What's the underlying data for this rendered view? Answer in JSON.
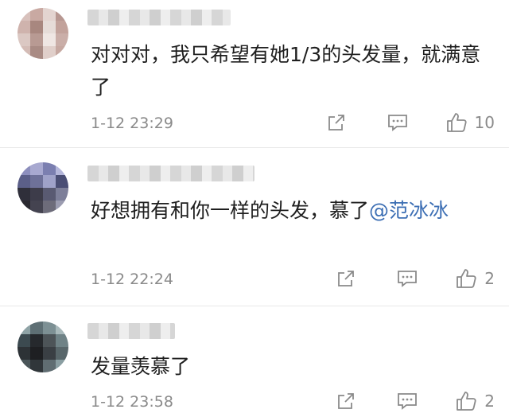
{
  "comments": [
    {
      "text": "对对对，我只希望有她1/3的头发量，就满意了",
      "mention": "",
      "time": "1-12 23:29",
      "likes": "10",
      "avatar_colors": [
        "#d8c1bc",
        "#c9a9a2",
        "#e3d4d0",
        "#b79791",
        "#cfb3ad",
        "#a8877f",
        "#e6dcd8",
        "#c2a29b",
        "#dbc8c3",
        "#b89a93",
        "#efe6e3",
        "#caaea8",
        "#d4bcb6",
        "#a98b84",
        "#e0cfca",
        "#c6a8a1"
      ]
    },
    {
      "text": "好想拥有和你一样的头发，慕了",
      "mention": "@范冰冰",
      "time": "1-12 22:24",
      "likes": "2",
      "avatar_colors": [
        "#8d8fbd",
        "#a8a9d0",
        "#7b7fb0",
        "#b4b6da",
        "#5b5f88",
        "#6e7199",
        "#9fa2c9",
        "#4a4e74",
        "#2f2f3a",
        "#3d3c4a",
        "#595a72",
        "#7d7f99",
        "#2a2930",
        "#444350",
        "#6d6c7a",
        "#9b9cb0"
      ]
    },
    {
      "text": "发量羡慕了",
      "mention": "",
      "time": "1-12 23:58",
      "likes": "2",
      "avatar_colors": [
        "#8fa3a6",
        "#5e6f74",
        "#7d9094",
        "#a9b9bb",
        "#3c4a50",
        "#26292d",
        "#4d5458",
        "#6f8286",
        "#2d3236",
        "#1e1f22",
        "#3a3f44",
        "#58666a",
        "#4a5559",
        "#30363a",
        "#606d72",
        "#8a9ea2"
      ]
    }
  ]
}
